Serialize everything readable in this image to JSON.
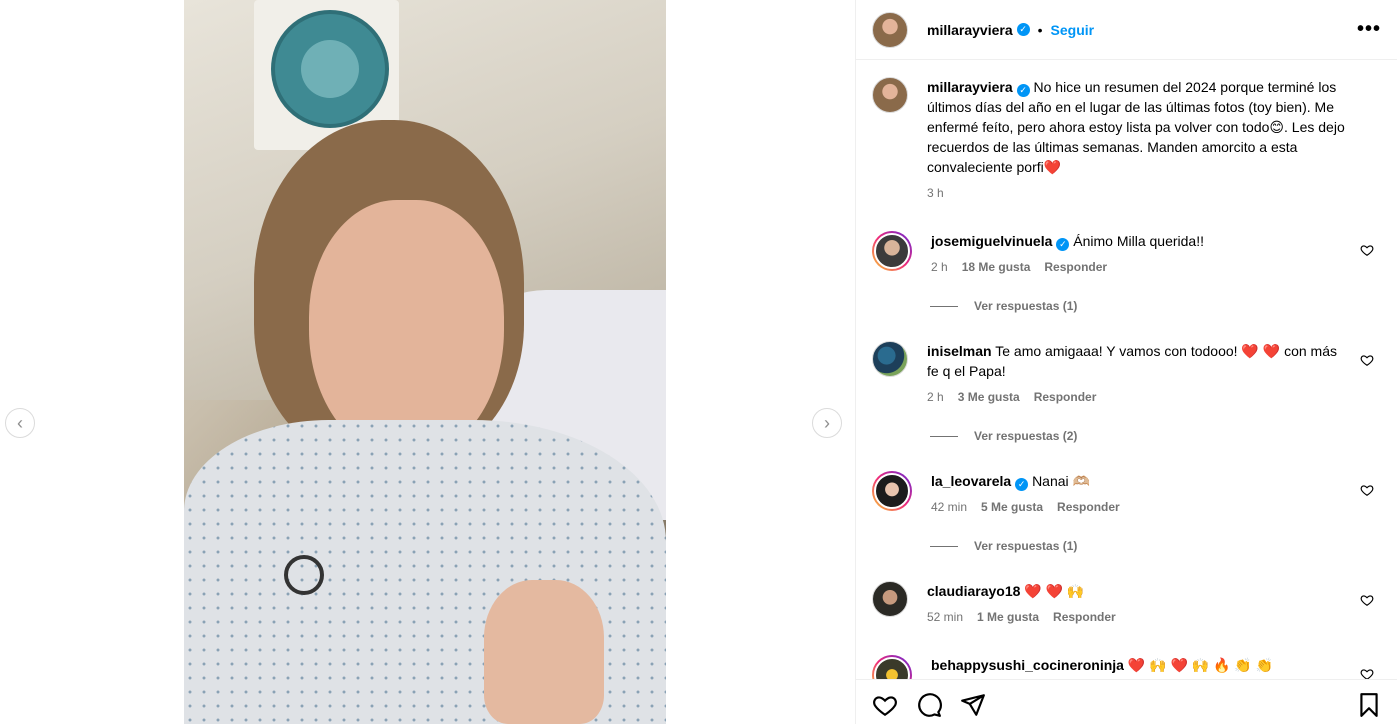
{
  "media": {
    "prev_label": "‹",
    "next_label": "›"
  },
  "post": {
    "username": "millarayviera",
    "verified_mark": "✓",
    "dot": "•",
    "follow_label": "Seguir",
    "more_label": "•••"
  },
  "caption": {
    "username": "millarayviera",
    "text": "No hice un resumen del 2024 porque terminé los últimos días del año en el lugar de las últimas fotos (toy bien). Me enfermé feíto, pero ahora estoy lista pa volver con todo😊. Les dejo recuerdos de las últimas semanas. Manden amorcito a esta convaleciente porfi",
    "text_heart": "❤️",
    "time": "3 h"
  },
  "comments": [
    {
      "username": "josemiguelvinuela",
      "verified": true,
      "text": "Ánimo Milla querida!!",
      "time": "2 h",
      "likes": "18 Me gusta",
      "reply": "Responder",
      "view_replies": "Ver respuestas (1)"
    },
    {
      "username": "iniselman",
      "verified": false,
      "text": "Te amo amigaaa! Y vamos con todooo! ❤️ ❤️  con más fe q el Papa!",
      "time": "2 h",
      "likes": "3 Me gusta",
      "reply": "Responder",
      "view_replies": "Ver respuestas (2)"
    },
    {
      "username": "la_leovarela",
      "verified": true,
      "text": "Nanai 🫶🏼",
      "time": "42 min",
      "likes": "5 Me gusta",
      "reply": "Responder",
      "view_replies": "Ver respuestas (1)"
    },
    {
      "username": "claudiarayo18",
      "verified": false,
      "text": "❤️ ❤️ 🙌",
      "time": "52 min",
      "likes": "1 Me gusta",
      "reply": "Responder",
      "view_replies": ""
    },
    {
      "username": "behappysushi_cocineroninja",
      "verified": false,
      "text": "❤️ 🙌 ❤️ 🙌 🔥 👏 👏",
      "time": "",
      "likes": "",
      "reply": "",
      "view_replies": ""
    }
  ],
  "actions": {
    "like_icon": "heart-icon",
    "comment_icon": "comment-icon",
    "share_icon": "share-icon",
    "save_icon": "bookmark-icon"
  },
  "colors": {
    "accent": "#0095f6",
    "verified": "#0095f6",
    "muted": "#737373",
    "border": "#efefef"
  }
}
